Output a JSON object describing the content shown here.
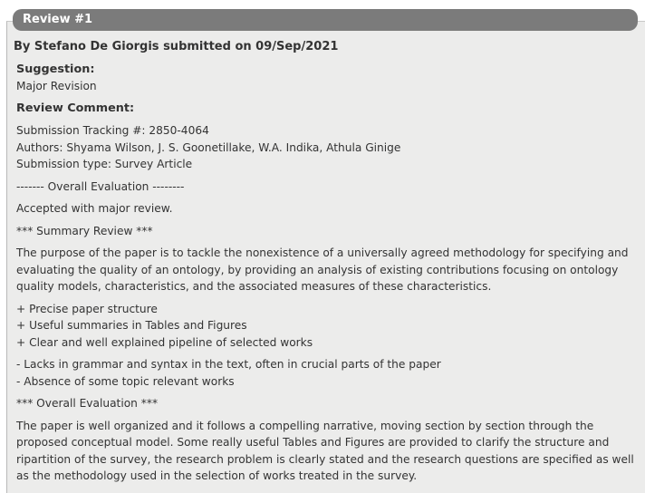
{
  "review": {
    "title": "Review #1",
    "byline": "By Stefano De Giorgis submitted on 09/Sep/2021",
    "suggestion_label": "Suggestion:",
    "suggestion_value": "Major Revision",
    "comment_label": "Review Comment:",
    "tracking": "Submission Tracking #: 2850-4064",
    "authors": "Authors: Shyama Wilson, J. S. Goonetillake, W.A. Indika, Athula Ginige",
    "submission_type": "Submission type: Survey Article",
    "overall_eval_divider": "------- Overall Evaluation --------",
    "accepted": "Accepted with major review.",
    "summary_heading": "*** Summary Review ***",
    "summary_paragraph": "The purpose of the paper is to tackle the nonexistence of a universally agreed methodology for specifying and evaluating the quality of an ontology, by providing an analysis of existing contributions focusing on ontology quality models, characteristics, and the associated measures of these characteristics.",
    "pros": [
      "+ Precise paper structure",
      "+ Useful summaries in Tables and Figures",
      "+ Clear and well explained pipeline of selected works"
    ],
    "cons": [
      "- Lacks in grammar and syntax in the text, often in crucial parts of the paper",
      "- Absence of some topic relevant works"
    ],
    "overall_heading": "*** Overall Evaluation ***",
    "overall_paragraph": "The paper is well organized and it follows a compelling narrative, moving section by section through the proposed conceptual model. Some really useful Tables and Figures are provided to clarify the structure and ripartition of the survey, the research problem is clearly stated and the research questions are specified as well as the methodology used in the selection of works treated in the survey."
  }
}
